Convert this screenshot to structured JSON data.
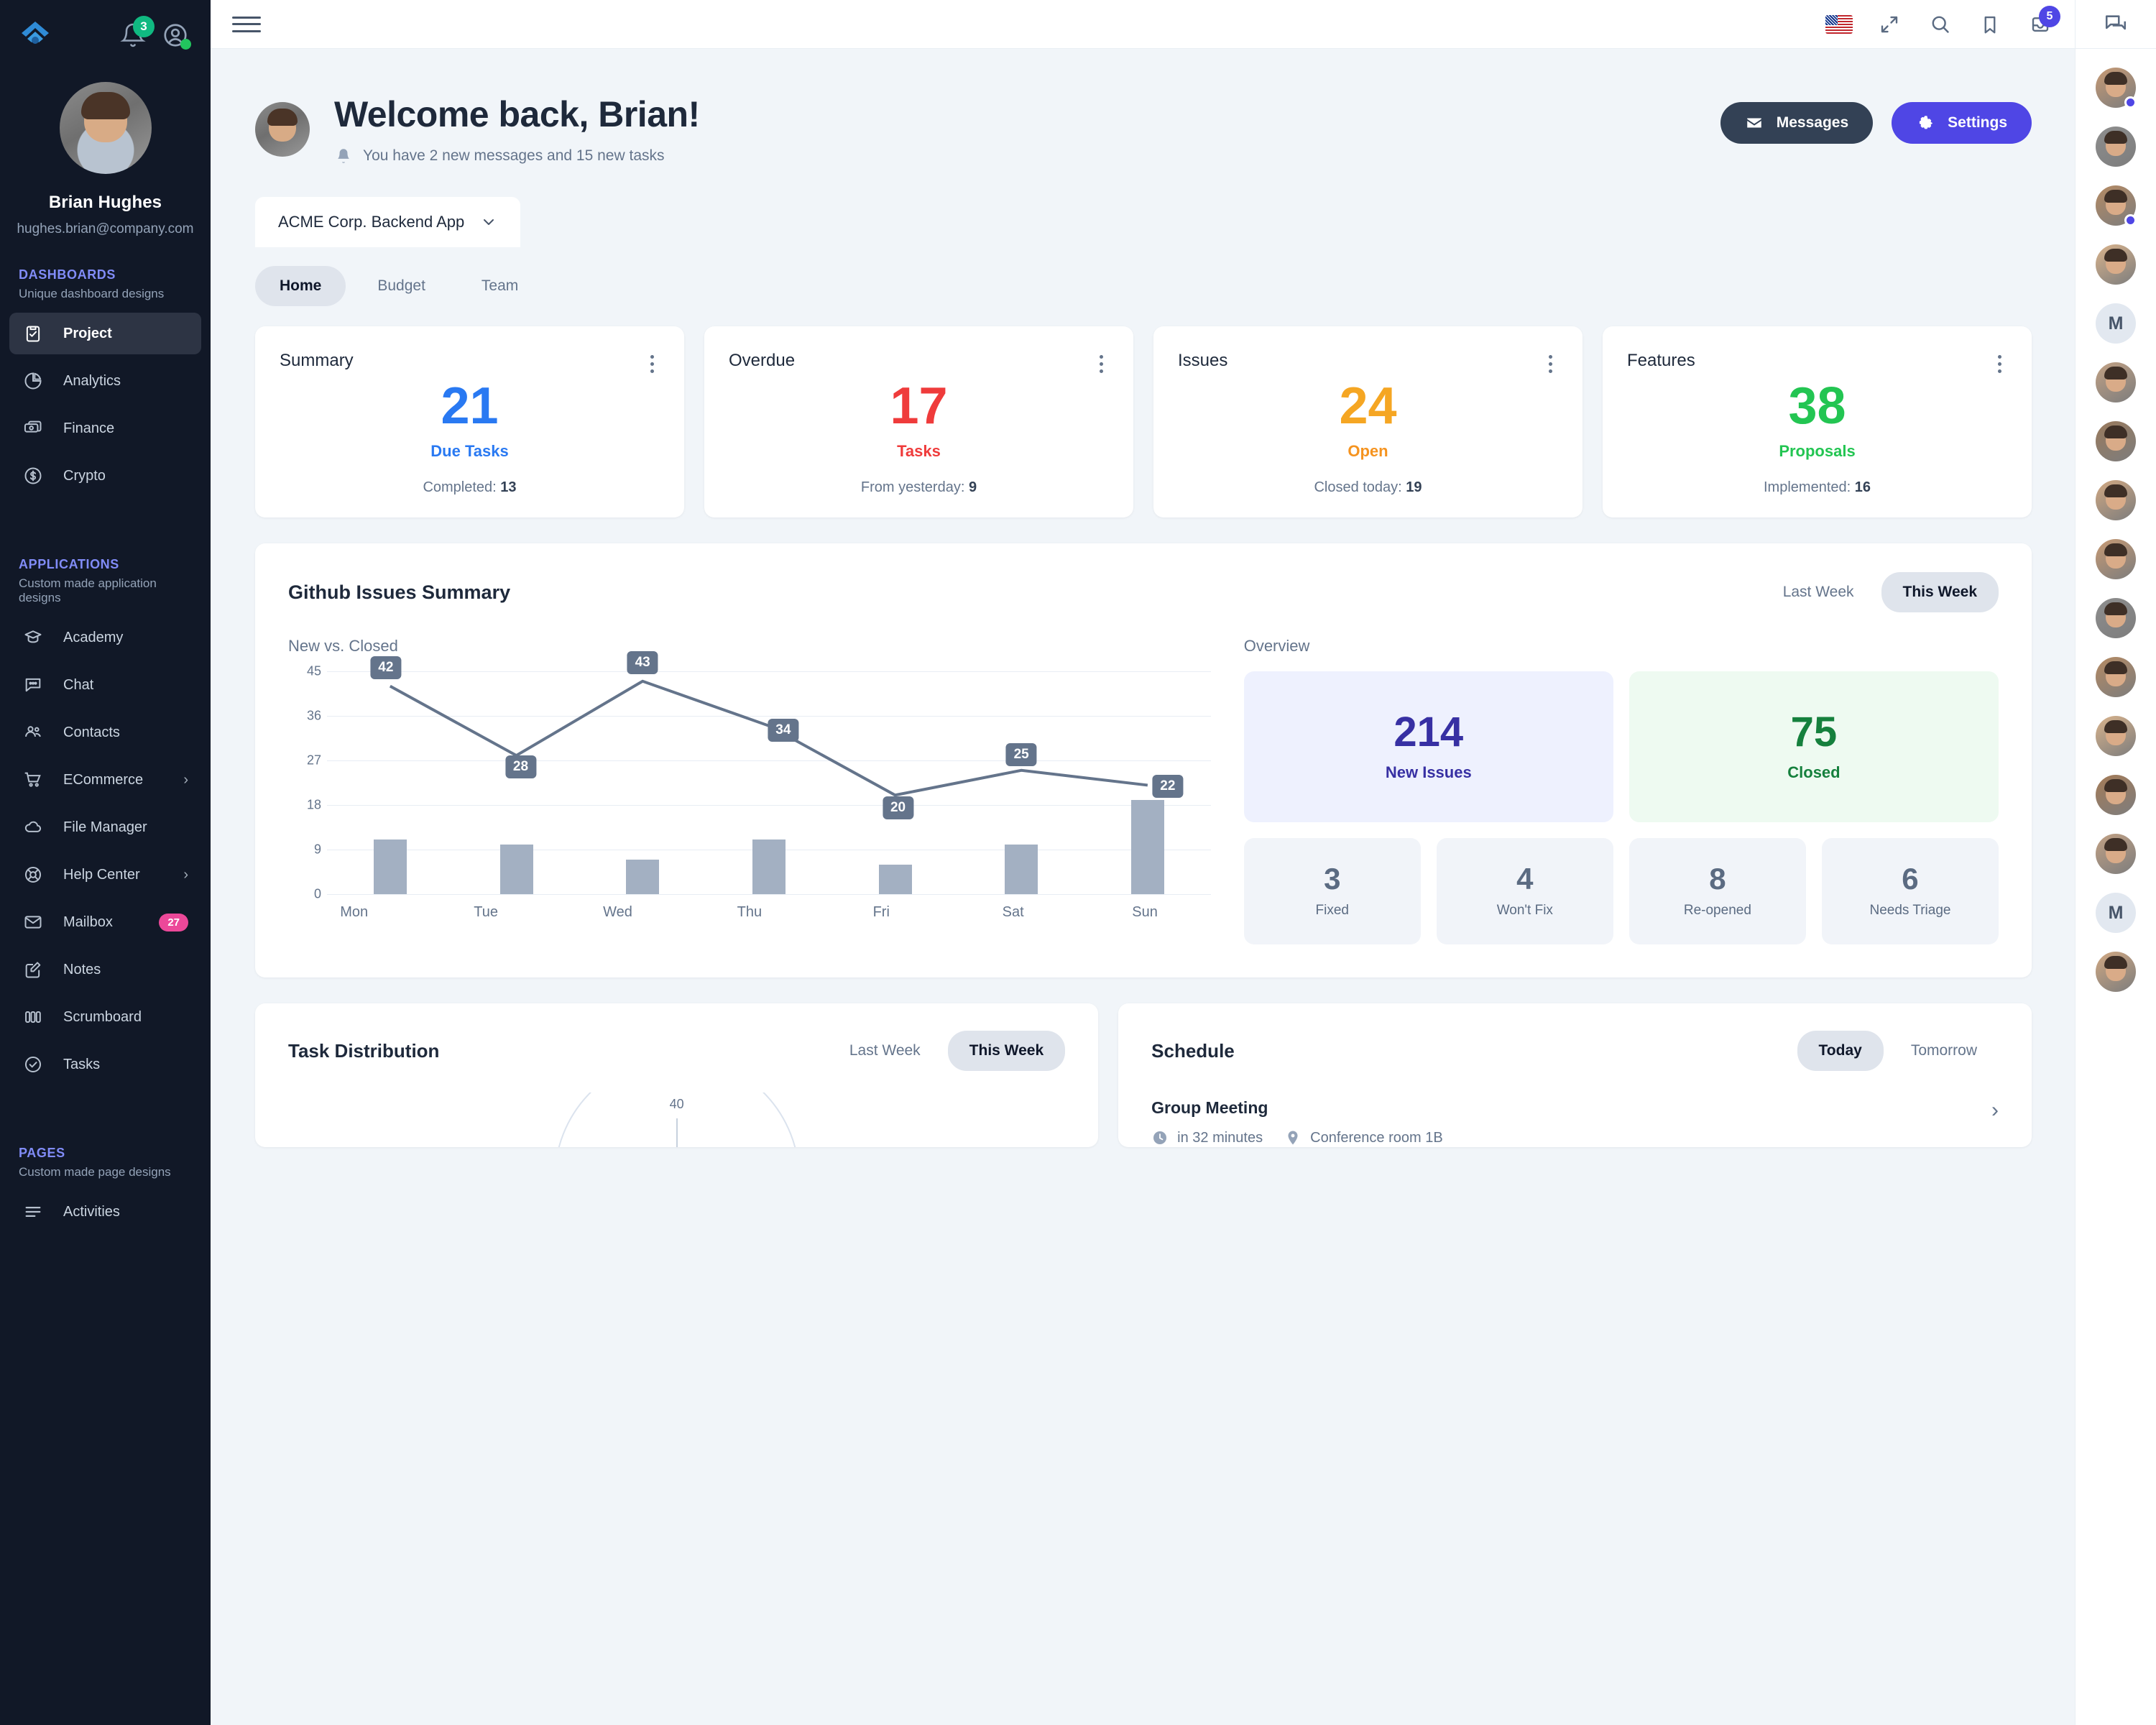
{
  "sidebar": {
    "notifications_badge": "3",
    "profile": {
      "name": "Brian Hughes",
      "email": "hughes.brian@company.com"
    },
    "sections": [
      {
        "title": "DASHBOARDS",
        "subtitle": "Unique dashboard designs",
        "items": [
          {
            "label": "Project",
            "icon": "clipboard-check-icon",
            "active": true
          },
          {
            "label": "Analytics",
            "icon": "pie-chart-icon"
          },
          {
            "label": "Finance",
            "icon": "banknotes-icon"
          },
          {
            "label": "Crypto",
            "icon": "dollar-circle-icon"
          }
        ]
      },
      {
        "title": "APPLICATIONS",
        "subtitle": "Custom made application designs",
        "items": [
          {
            "label": "Academy",
            "icon": "academic-cap-icon"
          },
          {
            "label": "Chat",
            "icon": "chat-bubble-icon"
          },
          {
            "label": "Contacts",
            "icon": "users-icon"
          },
          {
            "label": "ECommerce",
            "icon": "shopping-cart-icon",
            "chevron": "›"
          },
          {
            "label": "File Manager",
            "icon": "cloud-icon"
          },
          {
            "label": "Help Center",
            "icon": "lifebuoy-icon",
            "chevron": "›"
          },
          {
            "label": "Mailbox",
            "icon": "envelope-icon",
            "badge": "27"
          },
          {
            "label": "Notes",
            "icon": "pencil-square-icon"
          },
          {
            "label": "Scrumboard",
            "icon": "columns-icon"
          },
          {
            "label": "Tasks",
            "icon": "check-circle-icon"
          }
        ]
      },
      {
        "title": "PAGES",
        "subtitle": "Custom made page designs",
        "items": [
          {
            "label": "Activities",
            "icon": "list-icon"
          }
        ]
      }
    ]
  },
  "topbar": {
    "icons": [
      "menu-icon",
      "flag-us-icon",
      "fullscreen-icon",
      "search-icon",
      "bookmark-icon",
      "inbox-icon",
      "chat-panel-icon"
    ],
    "inbox_badge": "5"
  },
  "welcome": {
    "title": "Welcome back, Brian!",
    "subtitle": "You have 2 new messages and 15 new tasks",
    "messages_button": "Messages",
    "settings_button": "Settings"
  },
  "project": {
    "selector_label": "ACME Corp. Backend App",
    "tabs": [
      {
        "label": "Home",
        "active": true
      },
      {
        "label": "Budget",
        "active": false
      },
      {
        "label": "Team",
        "active": false
      }
    ]
  },
  "stat_cards": [
    {
      "title": "Summary",
      "value": "21",
      "label": "Due Tasks",
      "foot_label": "Completed:",
      "foot_value": "13",
      "color": "#2979f2"
    },
    {
      "title": "Overdue",
      "value": "17",
      "label": "Tasks",
      "foot_label": "From yesterday:",
      "foot_value": "9",
      "color": "#ef3b3b"
    },
    {
      "title": "Issues",
      "value": "24",
      "label": "Open",
      "foot_label": "Closed today:",
      "foot_value": "19",
      "color": "#f5a623"
    },
    {
      "title": "Features",
      "value": "38",
      "label": "Proposals",
      "foot_label": "Implemented:",
      "foot_value": "16",
      "color": "#23c552"
    }
  ],
  "github": {
    "title": "Github Issues Summary",
    "range_toggle": [
      {
        "label": "Last Week",
        "active": false
      },
      {
        "label": "This Week",
        "active": true
      }
    ],
    "left_label": "New vs. Closed",
    "right_label": "Overview",
    "overview_big": [
      {
        "value": "214",
        "label": "New Issues",
        "theme": "blue"
      },
      {
        "value": "75",
        "label": "Closed",
        "theme": "green"
      }
    ],
    "overview_small": [
      {
        "value": "3",
        "label": "Fixed"
      },
      {
        "value": "4",
        "label": "Won't Fix"
      },
      {
        "value": "8",
        "label": "Re-opened"
      },
      {
        "value": "6",
        "label": "Needs Triage"
      }
    ]
  },
  "chart_data": {
    "type": "line",
    "title": "New vs. Closed",
    "categories": [
      "Mon",
      "Tue",
      "Wed",
      "Thu",
      "Fri",
      "Sat",
      "Sun"
    ],
    "series": [
      {
        "name": "New",
        "type": "line",
        "values": [
          42,
          28,
          43,
          34,
          20,
          25,
          22
        ],
        "color": "#64748b",
        "labels": true
      },
      {
        "name": "Closed",
        "type": "bar",
        "values": [
          11,
          10,
          7,
          11,
          6,
          10,
          19
        ],
        "color": "#a3b0c2"
      }
    ],
    "xlabel": "",
    "ylabel": "",
    "ylim": [
      0,
      45
    ],
    "yticks": [
      0,
      9,
      18,
      27,
      36,
      45
    ],
    "grid": true,
    "legend": "none"
  },
  "task_distribution": {
    "title": "Task Distribution",
    "toggle": [
      {
        "label": "Last Week",
        "active": false
      },
      {
        "label": "This Week",
        "active": true
      }
    ],
    "radar_top_label": "40"
  },
  "schedule": {
    "title": "Schedule",
    "toggle": [
      {
        "label": "Today",
        "active": true
      },
      {
        "label": "Tomorrow",
        "active": false
      }
    ],
    "event_title": "Group Meeting",
    "event_time": "in 32 minutes",
    "event_location": "Conference room 1B"
  },
  "contacts_rail": [
    {
      "initial": "",
      "status": "#4f46e5"
    },
    {
      "initial": "",
      "status": ""
    },
    {
      "initial": "",
      "status": "#4f46e5"
    },
    {
      "initial": "",
      "status": ""
    },
    {
      "initial": "M",
      "status": ""
    },
    {
      "initial": "",
      "status": ""
    },
    {
      "initial": "",
      "status": ""
    },
    {
      "initial": "",
      "status": ""
    },
    {
      "initial": "",
      "status": ""
    },
    {
      "initial": "",
      "status": ""
    },
    {
      "initial": "",
      "status": ""
    },
    {
      "initial": "",
      "status": ""
    },
    {
      "initial": "",
      "status": ""
    },
    {
      "initial": "",
      "status": ""
    },
    {
      "initial": "M",
      "status": ""
    },
    {
      "initial": "",
      "status": ""
    }
  ]
}
